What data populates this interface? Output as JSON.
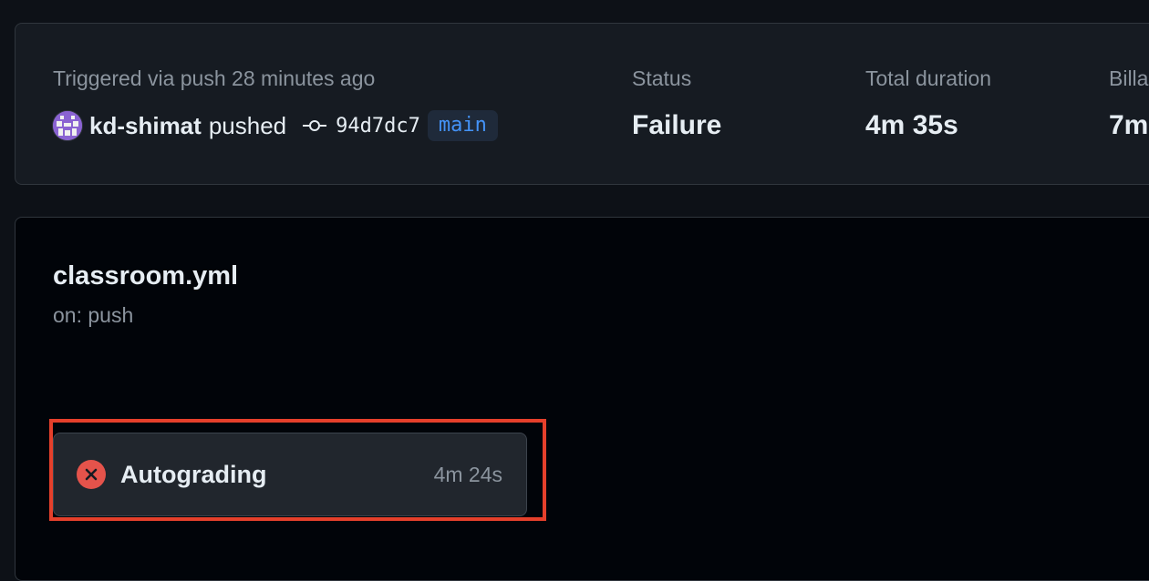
{
  "summary": {
    "trigger_text": "Triggered via push 28 minutes ago",
    "actor": "kd-shimat",
    "action": "pushed",
    "commit_sha": "94d7dc7",
    "branch": "main",
    "status_label": "Status",
    "status_value": "Failure",
    "duration_label": "Total duration",
    "duration_value": "4m 35s",
    "billable_label": "Billa",
    "billable_value": "7m"
  },
  "workflow": {
    "name": "classroom.yml",
    "trigger": "on: push",
    "jobs": [
      {
        "name": "Autograding",
        "duration": "4m 24s",
        "status": "failure",
        "status_color": "#e5534b"
      }
    ]
  },
  "colors": {
    "background": "#0d1117",
    "card": "#161b22",
    "branch_text": "#4493f8",
    "highlight": "#e5402b"
  }
}
